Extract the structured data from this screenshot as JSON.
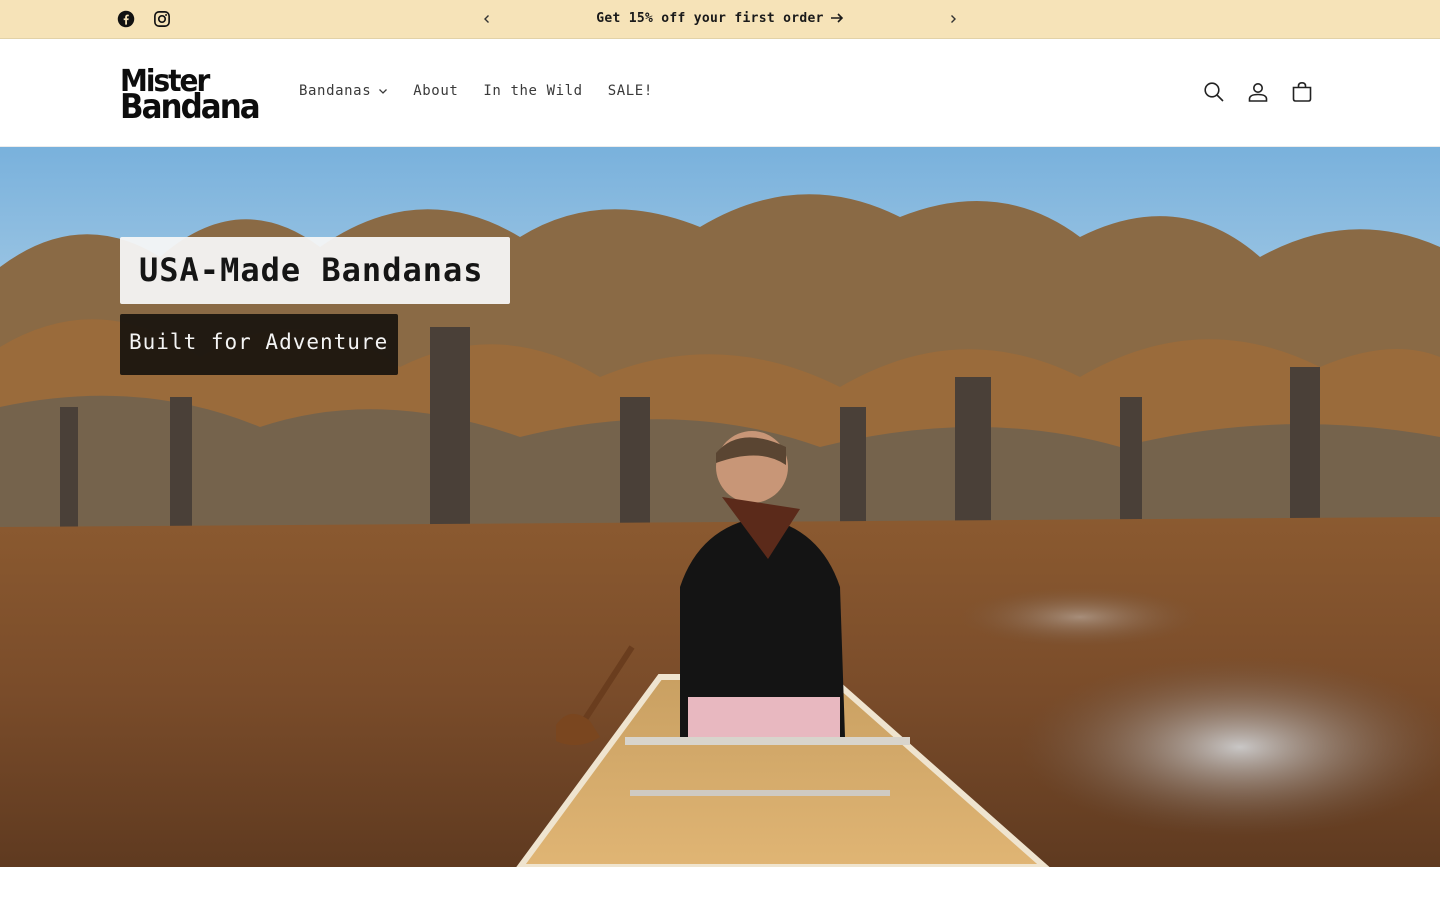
{
  "announcement": {
    "social": [
      "facebook-icon",
      "instagram-icon"
    ],
    "message": "Get 15% off your first order",
    "prev_icon": "chevron-left-icon",
    "next_icon": "chevron-right-icon"
  },
  "header": {
    "logo_line1": "Mister",
    "logo_line2": "Bandana",
    "nav": [
      {
        "label": "Bandanas",
        "has_dropdown": true
      },
      {
        "label": "About"
      },
      {
        "label": "In the Wild"
      },
      {
        "label": "SALE!"
      }
    ],
    "icons": [
      "search-icon",
      "account-icon",
      "cart-icon"
    ]
  },
  "hero": {
    "title": "USA-Made Bandanas",
    "subtitle": "Built for Adventure"
  },
  "colors": {
    "announcement_bg": "#f6e3b8",
    "text": "#121212",
    "subtitle_bg": "#18140e"
  }
}
